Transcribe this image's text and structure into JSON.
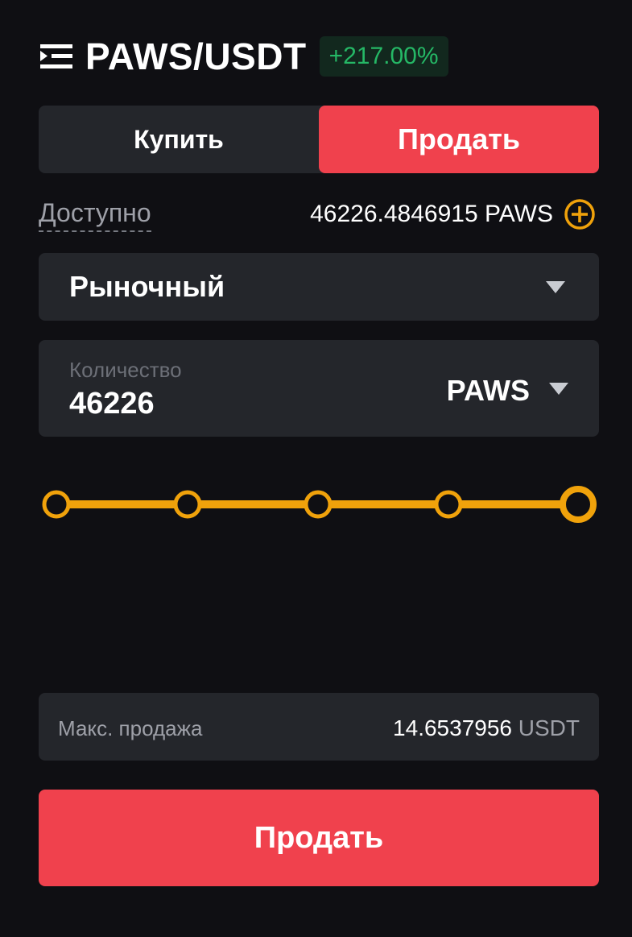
{
  "header": {
    "pair": "PAWS/USDT",
    "change": "+217.00%",
    "menu_icon": "list-collapse-icon"
  },
  "side_toggle": {
    "buy_label": "Купить",
    "sell_label": "Продать",
    "active": "sell"
  },
  "available": {
    "label": "Доступно",
    "value": "46226.4846915 PAWS",
    "add_icon": "plus-circle-icon"
  },
  "order_type": {
    "selected": "Рыночный"
  },
  "quantity": {
    "placeholder": "Количество",
    "value": "46226",
    "unit": "PAWS"
  },
  "slider": {
    "stops": 5,
    "level_percent": 100
  },
  "max_sell": {
    "label": "Макс. продажа",
    "value": "14.6537956",
    "unit": "USDT"
  },
  "submit": {
    "label": "Продать"
  },
  "colors": {
    "background": "#0f0f13",
    "panel": "#24262b",
    "sell": "#f0414d",
    "positive": "#25b866",
    "accent": "#f0a20b"
  }
}
